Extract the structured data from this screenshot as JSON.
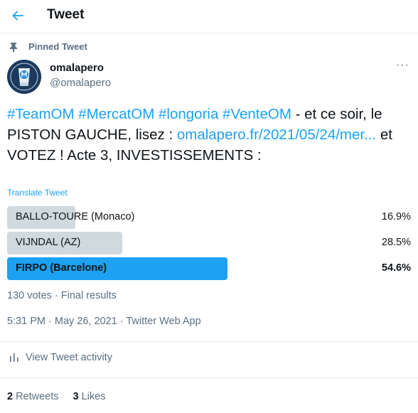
{
  "header": {
    "title": "Tweet"
  },
  "pinned": {
    "label": "Pinned Tweet"
  },
  "author": {
    "name": "omalapero",
    "handle": "@omalapero"
  },
  "tweet": {
    "segments": [
      {
        "text": "#TeamOM #MercatOM #longoria #VenteOM",
        "link": true
      },
      {
        "text": " - et ce soir, le PISTON GAUCHE, lisez : ",
        "link": false
      },
      {
        "text": "omalapero.fr/2021/05/24/mer...",
        "link": true
      },
      {
        "text": " et VOTEZ ! Acte 3, INVESTISSEMENTS :",
        "link": false
      }
    ],
    "translate_label": "Translate Tweet"
  },
  "poll": {
    "options": [
      {
        "label": "BALLO-TOURE (Monaco)",
        "percent": "16.9%",
        "fraction": 0.169,
        "winner": false
      },
      {
        "label": "VIJNDAL (AZ)",
        "percent": "28.5%",
        "fraction": 0.285,
        "winner": false
      },
      {
        "label": "FIRPO (Barcelone)",
        "percent": "54.6%",
        "fraction": 0.546,
        "winner": true
      }
    ],
    "summary": "130 votes · Final results"
  },
  "meta": {
    "timestamp": "5:31 PM · May 26, 2021 · Twitter Web App"
  },
  "activity": {
    "label": "View Tweet activity"
  },
  "stats": {
    "retweets_count": "2",
    "retweets_label": "Retweets",
    "likes_count": "3",
    "likes_label": "Likes"
  },
  "colors": {
    "accent": "#1da1f2",
    "poll_bar": "#cfd9de",
    "muted_text": "#5b7083"
  }
}
